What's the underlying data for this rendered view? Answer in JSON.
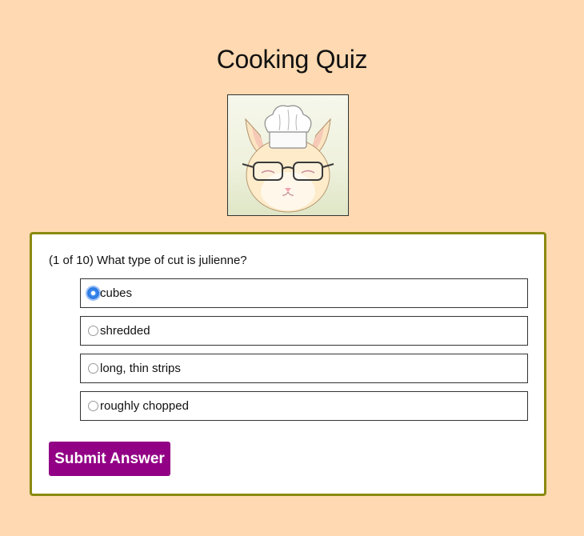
{
  "page": {
    "title": "Cooking Quiz"
  },
  "mascot": {
    "icon": "chef-cat-mascot"
  },
  "quiz": {
    "question": "(1 of 10) What type of cut is julienne?",
    "options": [
      {
        "label": "cubes",
        "selected": true
      },
      {
        "label": "shredded",
        "selected": false
      },
      {
        "label": "long, thin strips",
        "selected": false
      },
      {
        "label": "roughly chopped",
        "selected": false
      }
    ],
    "submit_label": "Submit Answer"
  },
  "colors": {
    "background": "#fed9b1",
    "card_border": "#8a8a10",
    "submit_button": "#920085",
    "radio_selected": "#2c7be5"
  }
}
